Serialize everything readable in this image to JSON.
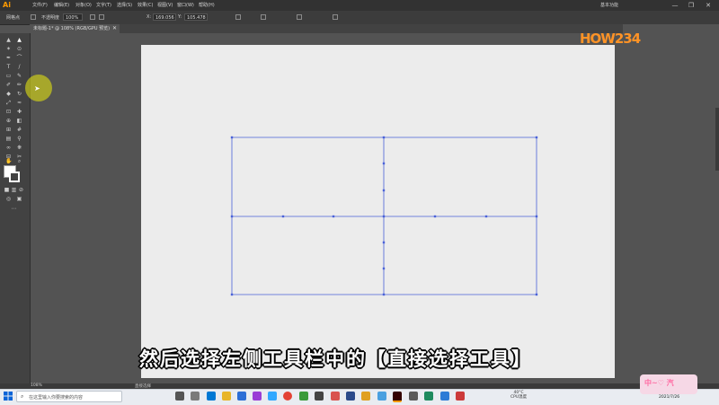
{
  "menubar": {
    "app_logo": "Ai",
    "items": [
      "文件(F)",
      "编辑(E)",
      "对象(O)",
      "文字(T)",
      "选择(S)",
      "效果(C)",
      "视图(V)",
      "窗口(W)",
      "帮助(H)"
    ],
    "workspace": "基本功能",
    "minimize": "—",
    "maximize": "❐",
    "close": "✕"
  },
  "controlbar": {
    "selection_label": "网格点",
    "opacity_label": "不透明度",
    "opacity_value": "100%",
    "x_label": "X:",
    "x_value": "169.056",
    "y_label": "Y:",
    "y_value": "105.478"
  },
  "document": {
    "tab_label": "未标题-1* @ 108% (RGB/GPU 预览)",
    "tab_close": "✕"
  },
  "watermark": "HOW234",
  "status": {
    "zoom": "108%",
    "tool": "直接选择"
  },
  "subtitle": "然后选择左侧工具栏中的【直接选择工具】",
  "taskbar": {
    "search_placeholder": "在这里输入你要搜索的内容",
    "weather_temp": "40°C",
    "weather_desc": "CPU温度",
    "time": "17:21",
    "date": "2021/7/26",
    "badge": "中~♡ 汽"
  },
  "colors": {
    "grid_line": "#4a62d8",
    "artboard": "#ececec",
    "highlight": "#dcdc14",
    "accent": "#ff9326"
  },
  "icons": {
    "cursor": "arrow-cursor-icon",
    "search": "search-icon",
    "start": "windows-start-icon"
  }
}
